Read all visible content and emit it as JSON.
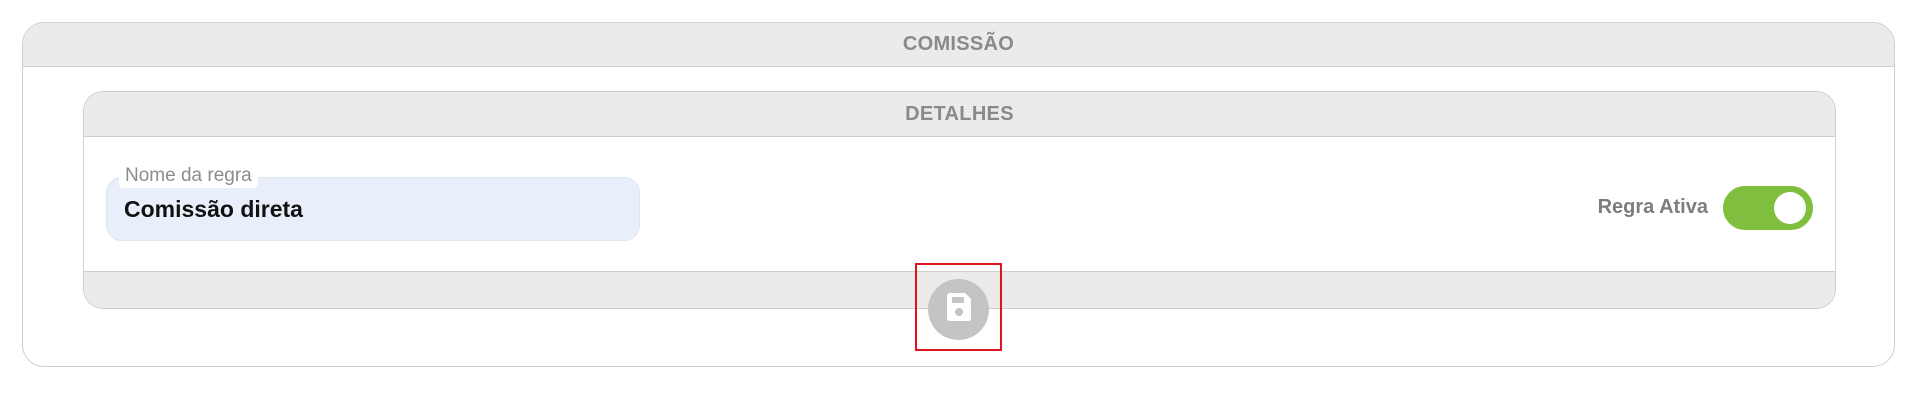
{
  "commission": {
    "title": "COMISSÃO"
  },
  "details": {
    "title": "DETALHES",
    "rule_name": {
      "label": "Nome da regra",
      "value": "Comissão direta"
    },
    "active_toggle": {
      "label": "Regra Ativa",
      "checked": true
    }
  },
  "save_button": {
    "icon": "floppy-disk-icon"
  },
  "colors": {
    "accent_green": "#80be3f",
    "header_bg": "#ebebeb",
    "input_bg": "#e8eefa",
    "highlight_red": "#e0141e"
  }
}
